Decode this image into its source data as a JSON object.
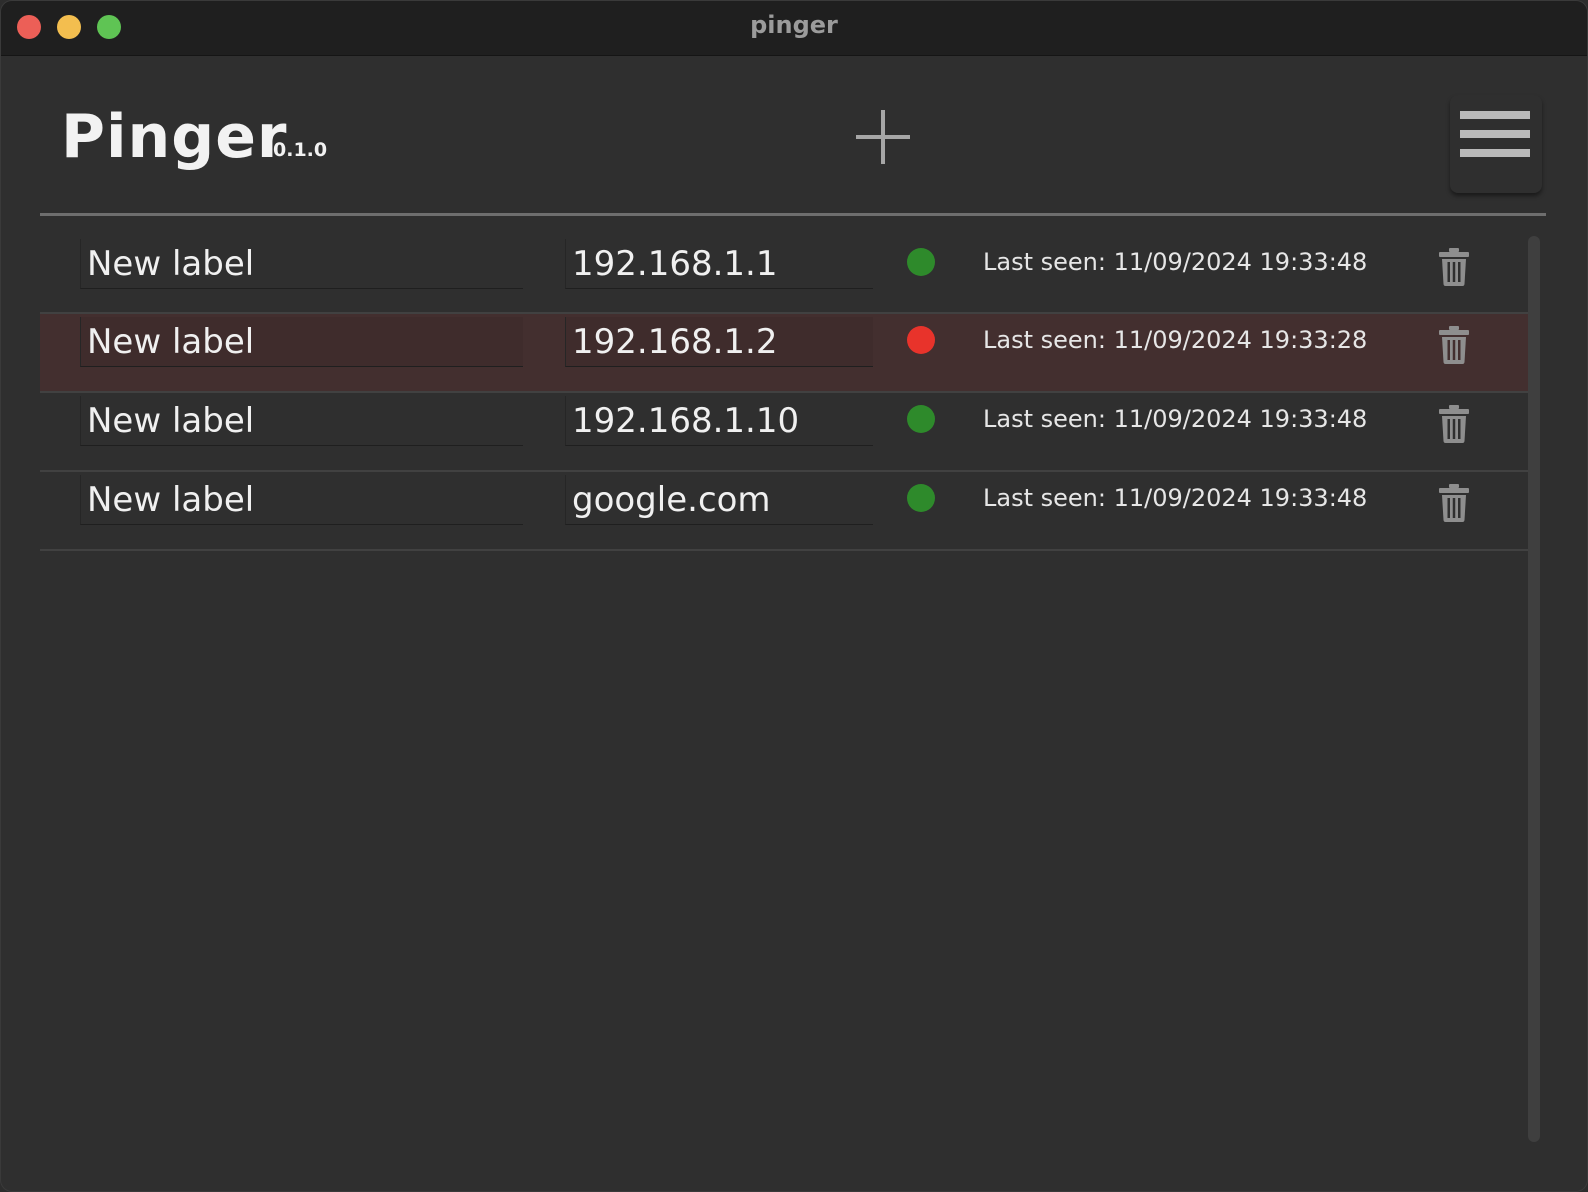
{
  "window": {
    "title": "pinger"
  },
  "header": {
    "app_name": "Pinger",
    "version": "0.1.0",
    "add_icon": "plus-icon",
    "menu_icon": "hamburger-menu-icon"
  },
  "colors": {
    "status_up": "#2e8a2b",
    "status_down": "#e8332b",
    "row_down_background": "#432f2f",
    "background": "#2f2f2f"
  },
  "hosts": [
    {
      "label": "New label",
      "host": "192.168.1.1",
      "status": "up",
      "last_seen": "Last seen: 11/09/2024 19:33:48"
    },
    {
      "label": "New label",
      "host": "192.168.1.2",
      "status": "down",
      "last_seen": "Last seen: 11/09/2024 19:33:28"
    },
    {
      "label": "New label",
      "host": "192.168.1.10",
      "status": "up",
      "last_seen": "Last seen: 11/09/2024 19:33:48"
    },
    {
      "label": "New label",
      "host": "google.com",
      "status": "up",
      "last_seen": "Last seen: 11/09/2024 19:33:48"
    }
  ]
}
